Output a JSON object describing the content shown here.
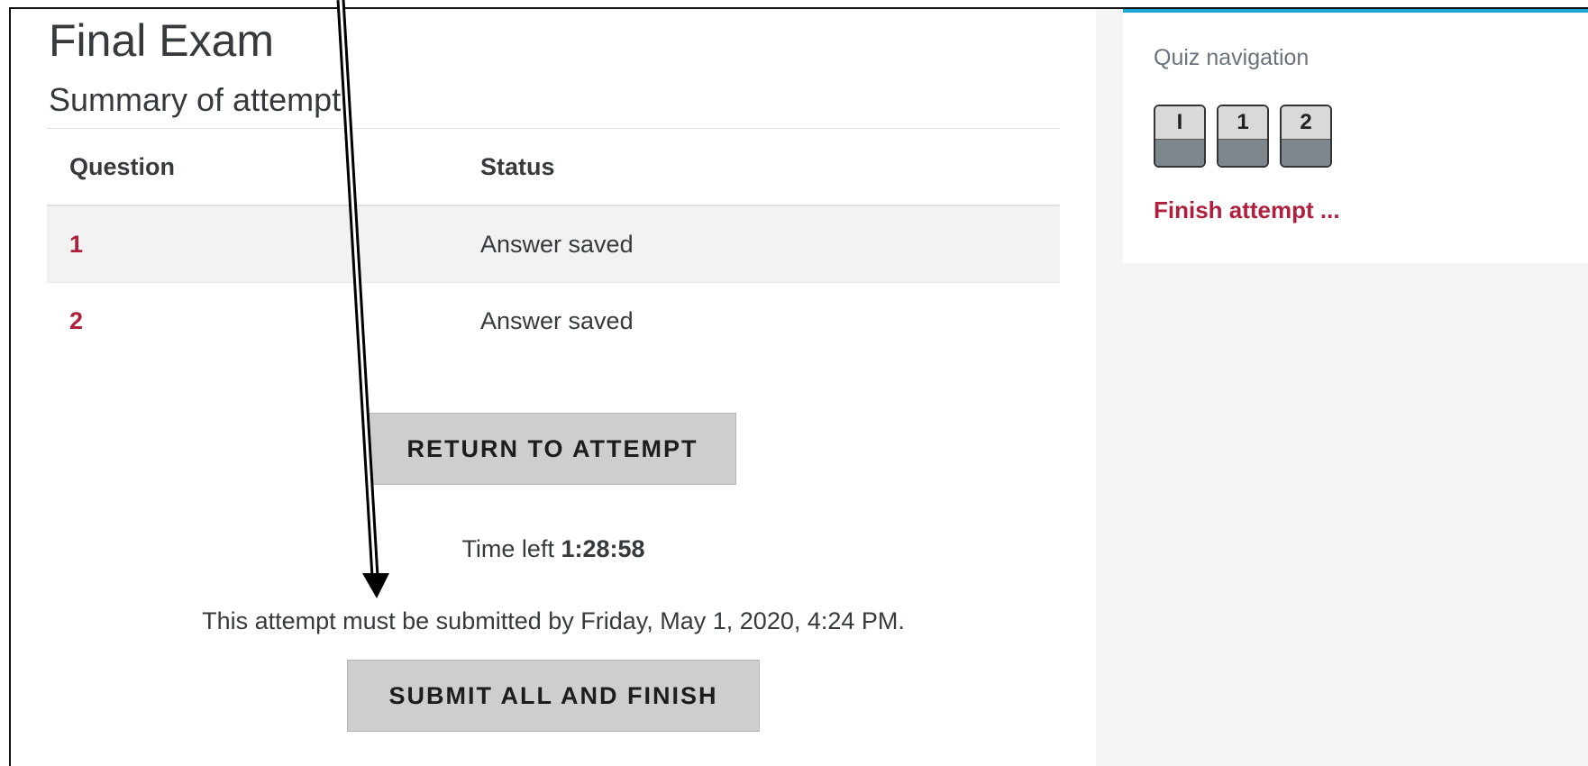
{
  "quiz": {
    "title": "Final Exam",
    "subtitle": "Summary of attempt",
    "table": {
      "headers": [
        "Question",
        "Status"
      ],
      "rows": [
        {
          "question": "1",
          "status": "Answer saved"
        },
        {
          "question": "2",
          "status": "Answer saved"
        }
      ]
    },
    "return_button": "RETURN TO ATTEMPT",
    "time_left_label": "Time left",
    "time_left_value": "1:28:58",
    "deadline_text": "This attempt must be submitted by Friday, May 1, 2020, 4:24 PM.",
    "submit_button": "SUBMIT ALL AND FINISH"
  },
  "navigation": {
    "title": "Quiz navigation",
    "buttons": [
      "I",
      "1",
      "2"
    ],
    "finish_link": "Finish attempt ..."
  },
  "colors": {
    "link": "#b01f3b",
    "accent": "#1ea7d6",
    "button_bg": "#cecece",
    "nav_button_bottom": "#7f878e"
  }
}
